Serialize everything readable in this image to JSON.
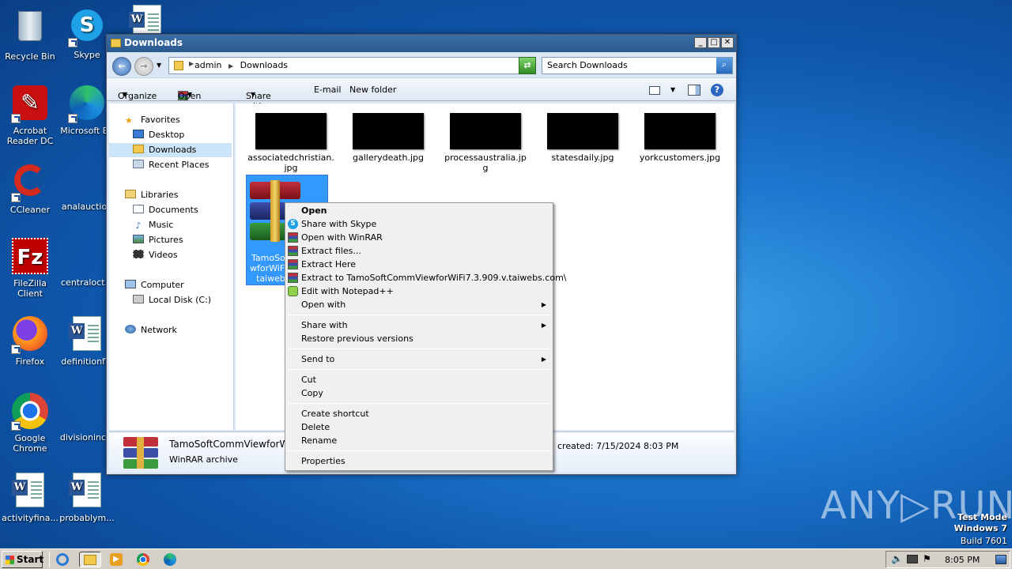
{
  "desktop": {
    "icons": [
      {
        "label": "Recycle Bin"
      },
      {
        "label": "Skype"
      },
      {
        "label": "Acrobat Reader DC"
      },
      {
        "label": "Microsoft Ed"
      },
      {
        "label": "CCleaner"
      },
      {
        "label": "analauction"
      },
      {
        "label": "FileZilla Client"
      },
      {
        "label": "centraloct.p"
      },
      {
        "label": "Firefox"
      },
      {
        "label": "definitionfla"
      },
      {
        "label": "Google Chrome"
      },
      {
        "label": "divisioninclu"
      },
      {
        "label": "activityfina..."
      },
      {
        "label": "probablym..."
      }
    ]
  },
  "window": {
    "title": "Downloads",
    "buttons": {
      "minimize": "_",
      "maximize": "□",
      "close": "✕"
    },
    "address": {
      "parts": [
        "admin",
        "Downloads"
      ]
    },
    "search": {
      "placeholder": "Search Downloads"
    },
    "toolbar": {
      "organize": "Organize",
      "open": "Open",
      "share_with": "Share with",
      "email": "E-mail",
      "new_folder": "New folder"
    },
    "nav": {
      "favorites": "Favorites",
      "desktop": "Desktop",
      "downloads": "Downloads",
      "recent_places": "Recent Places",
      "libraries": "Libraries",
      "documents": "Documents",
      "music": "Music",
      "pictures": "Pictures",
      "videos": "Videos",
      "computer": "Computer",
      "local_disk": "Local Disk (C:)",
      "network": "Network"
    },
    "files": [
      {
        "line1": "associatedchristian.",
        "line2": "jpg"
      },
      {
        "line1": "gallerydeath.jpg",
        "line2": ""
      },
      {
        "line1": "processaustralia.jp",
        "line2": "g"
      },
      {
        "line1": "statesdaily.jpg",
        "line2": ""
      },
      {
        "line1": "yorkcustomers.jpg",
        "line2": ""
      }
    ],
    "selected_file": {
      "line1": "TamoSof",
      "line2": "wforWiFi",
      "line3": "taiwebs"
    },
    "details": {
      "name": "TamoSoftCommViewforWi",
      "type": "WinRAR archive",
      "created": "created: 7/15/2024 8:03 PM"
    }
  },
  "context_menu": {
    "open": "Open",
    "share_skype": "Share with Skype",
    "open_winrar": "Open with WinRAR",
    "extract_files": "Extract files...",
    "extract_here": "Extract Here",
    "extract_to": "Extract to TamoSoftCommViewforWiFi7.3.909.v.taiwebs.com\\",
    "edit_notepad": "Edit with Notepad++",
    "open_with": "Open with",
    "share_with": "Share with",
    "restore": "Restore previous versions",
    "send_to": "Send to",
    "cut": "Cut",
    "copy": "Copy",
    "create_shortcut": "Create shortcut",
    "delete": "Delete",
    "rename": "Rename",
    "properties": "Properties"
  },
  "taskbar": {
    "start": "Start",
    "clock": "8:05 PM"
  },
  "overlay": {
    "watermark": "ANY▷RUN",
    "test_mode": "Test Mode",
    "os": "Windows 7",
    "build": "Build 7601"
  }
}
